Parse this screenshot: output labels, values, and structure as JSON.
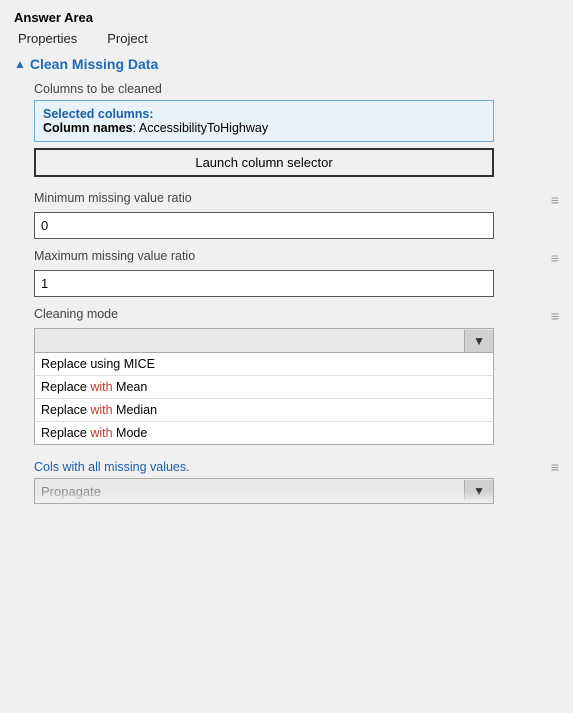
{
  "answer_area": {
    "label": "Answer Area",
    "tabs": [
      {
        "id": "properties",
        "label": "Properties"
      },
      {
        "id": "project",
        "label": "Project"
      }
    ],
    "section": {
      "title": "Clean Missing Data",
      "triangle": "▲"
    },
    "columns_to_be_cleaned": {
      "label": "Columns to be cleaned",
      "selected_label": "Selected columns:",
      "column_names_key": "Column names",
      "column_names_value": "AccessibilityToHighway"
    },
    "launch_btn_label": "Launch column selector",
    "minimum_missing": {
      "label": "Minimum missing value ratio",
      "value": "0"
    },
    "maximum_missing": {
      "label": "Maximum missing value ratio",
      "value": "1"
    },
    "cleaning_mode": {
      "label": "Cleaning mode",
      "dropdown_value": "",
      "options": [
        {
          "id": "mice",
          "label": "Replace using MICE",
          "highlight": ""
        },
        {
          "id": "mean",
          "label": "Replace with Mean",
          "highlight": "with"
        },
        {
          "id": "median",
          "label": "Replace with Median",
          "highlight": "with"
        },
        {
          "id": "mode",
          "label": "Replace with Mode",
          "highlight": "with"
        }
      ]
    },
    "cols_missing": {
      "label": "Cols with all missing values.",
      "dropdown_value": "Propagate"
    },
    "drag_icon": "≡"
  }
}
